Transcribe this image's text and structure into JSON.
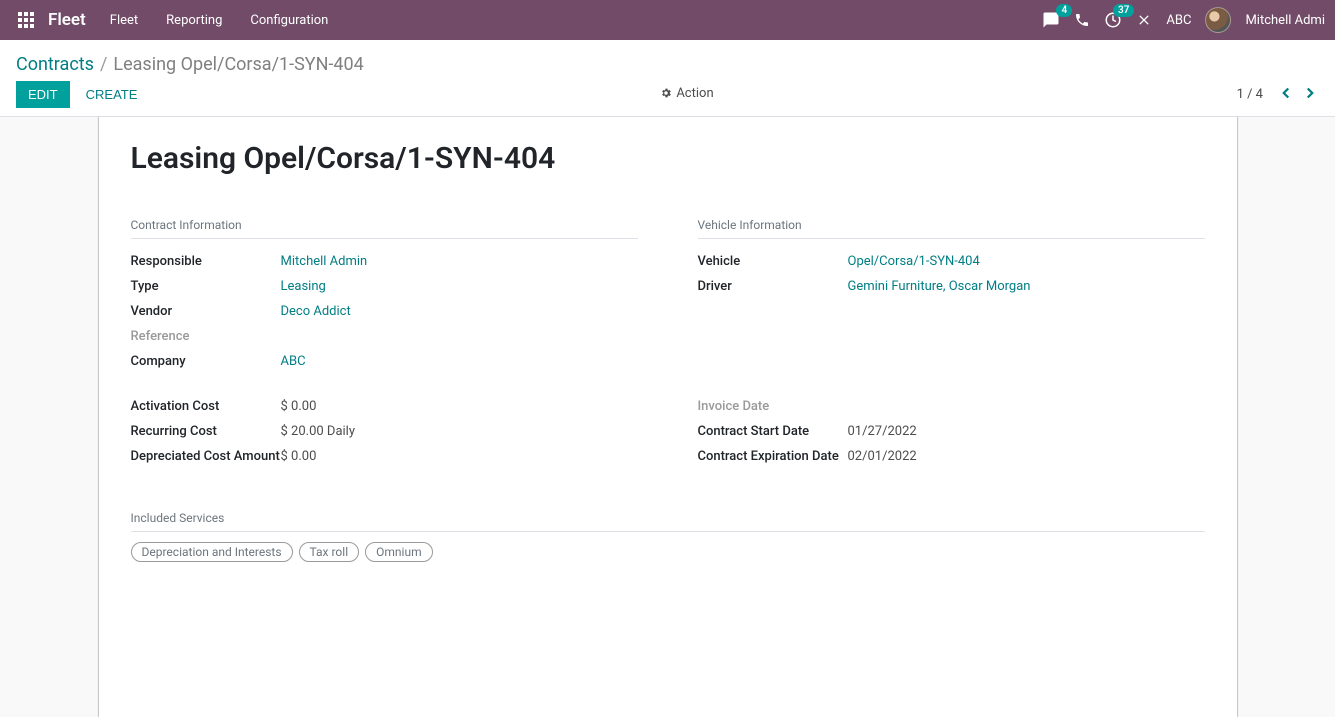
{
  "topnav": {
    "brand": "Fleet",
    "menu": [
      "Fleet",
      "Reporting",
      "Configuration"
    ],
    "chat_badge": "4",
    "activity_badge": "37",
    "company": "ABC",
    "user": "Mitchell Admi"
  },
  "breadcrumb": {
    "root": "Contracts",
    "current": "Leasing Opel/Corsa/1-SYN-404"
  },
  "buttons": {
    "edit": "EDIT",
    "create": "CREATE",
    "action": "Action"
  },
  "pager": {
    "text": "1 / 4"
  },
  "record": {
    "title": "Leasing Opel/Corsa/1-SYN-404",
    "section_contract": "Contract Information",
    "section_vehicle": "Vehicle Information",
    "section_services": "Included Services",
    "labels": {
      "responsible": "Responsible",
      "type": "Type",
      "vendor": "Vendor",
      "reference": "Reference",
      "company": "Company",
      "vehicle": "Vehicle",
      "driver": "Driver",
      "activation_cost": "Activation Cost",
      "recurring_cost": "Recurring Cost",
      "depreciated": "Depreciated Cost Amount",
      "invoice_date": "Invoice Date",
      "start_date": "Contract Start Date",
      "expire_date": "Contract Expiration Date"
    },
    "values": {
      "responsible": "Mitchell Admin",
      "type": "Leasing",
      "vendor": "Deco Addict",
      "reference": "",
      "company": "ABC",
      "vehicle": "Opel/Corsa/1-SYN-404",
      "driver": "Gemini Furniture, Oscar Morgan",
      "activation_cost": "$ 0.00",
      "recurring_cost": "$ 20.00  Daily",
      "depreciated": "$ 0.00",
      "invoice_date": "",
      "start_date": "01/27/2022",
      "expire_date": "02/01/2022"
    },
    "tags": [
      "Depreciation and Interests",
      "Tax roll",
      "Omnium"
    ]
  }
}
